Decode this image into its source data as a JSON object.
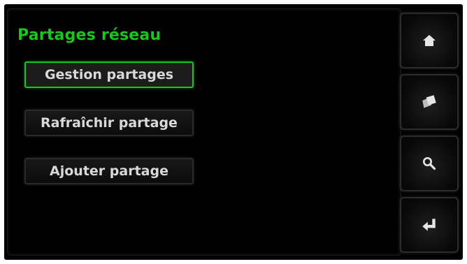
{
  "screen": {
    "title": "Partages réseau",
    "accent_color": "#19c61c",
    "text_color": "#d9d9d9",
    "background": "#000000"
  },
  "menu": {
    "items": [
      {
        "label": "Gestion partages",
        "selected": true
      },
      {
        "label": "Rafraîchir partage",
        "selected": false
      },
      {
        "label": "Ajouter partage",
        "selected": false
      }
    ]
  },
  "side_buttons": [
    {
      "icon": "home-icon"
    },
    {
      "icon": "cards-icon"
    },
    {
      "icon": "search-icon"
    },
    {
      "icon": "enter-return-icon"
    }
  ]
}
